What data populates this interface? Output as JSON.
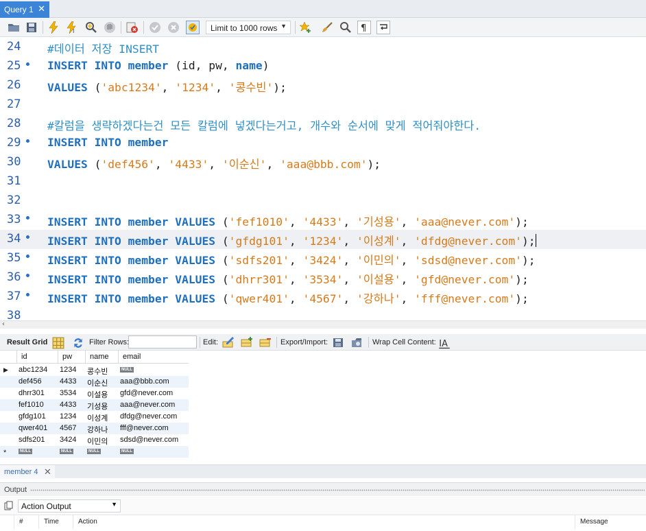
{
  "tab": {
    "title": "Query 1",
    "close": "✕"
  },
  "toolbar": {
    "limit_select": "Limit to 1000 rows",
    "icons": [
      "open-folder-icon",
      "save-icon",
      "execute-icon",
      "execute-current-icon",
      "explain-icon",
      "stop-icon",
      "toggle-error-icon",
      "commit-icon",
      "rollback-icon",
      "autocommit-icon",
      "beautify-icon",
      "brush-icon",
      "find-icon",
      "invisible-chars-icon",
      "wrap-icon"
    ]
  },
  "editor": {
    "lines": [
      {
        "n": "24",
        "dot": false,
        "segments": [
          {
            "t": "#데이터 저장 INSERT",
            "c": "cmt"
          }
        ]
      },
      {
        "n": "25",
        "dot": true,
        "segments": [
          {
            "t": "INSERT INTO member ",
            "c": "kw"
          },
          {
            "t": "(id, pw, ",
            "c": ""
          },
          {
            "t": "name",
            "c": "kw"
          },
          {
            "t": ")",
            "c": ""
          }
        ]
      },
      {
        "n": "26",
        "dot": false,
        "segments": [
          {
            "t": "VALUES ",
            "c": "kw"
          },
          {
            "t": "(",
            "c": ""
          },
          {
            "t": "'abc1234'",
            "c": "str"
          },
          {
            "t": ", ",
            "c": ""
          },
          {
            "t": "'1234'",
            "c": "str"
          },
          {
            "t": ", ",
            "c": ""
          },
          {
            "t": "'콩수빈'",
            "c": "str"
          },
          {
            "t": ");",
            "c": ""
          }
        ]
      },
      {
        "n": "27",
        "dot": false,
        "segments": []
      },
      {
        "n": "28",
        "dot": false,
        "segments": [
          {
            "t": "#칼럼을 생략하겠다는건 모든 칼럼에 넣겠다는거고, 개수와 순서에 맞게 적어줘야한다.",
            "c": "cmt"
          }
        ]
      },
      {
        "n": "29",
        "dot": true,
        "segments": [
          {
            "t": "INSERT INTO member",
            "c": "kw"
          }
        ]
      },
      {
        "n": "30",
        "dot": false,
        "segments": [
          {
            "t": "VALUES ",
            "c": "kw"
          },
          {
            "t": "(",
            "c": ""
          },
          {
            "t": "'def456'",
            "c": "str"
          },
          {
            "t": ", ",
            "c": ""
          },
          {
            "t": "'4433'",
            "c": "str"
          },
          {
            "t": ", ",
            "c": ""
          },
          {
            "t": "'이순신'",
            "c": "str"
          },
          {
            "t": ", ",
            "c": ""
          },
          {
            "t": "'aaa@bbb.com'",
            "c": "str"
          },
          {
            "t": ");",
            "c": ""
          }
        ]
      },
      {
        "n": "31",
        "dot": false,
        "segments": []
      },
      {
        "n": "32",
        "dot": false,
        "segments": []
      },
      {
        "n": "33",
        "dot": true,
        "segments": [
          {
            "t": "INSERT INTO member VALUES ",
            "c": "kw"
          },
          {
            "t": "(",
            "c": ""
          },
          {
            "t": "'fef1010'",
            "c": "str"
          },
          {
            "t": ", ",
            "c": ""
          },
          {
            "t": "'4433'",
            "c": "str"
          },
          {
            "t": ", ",
            "c": ""
          },
          {
            "t": "'기성용'",
            "c": "str"
          },
          {
            "t": ", ",
            "c": ""
          },
          {
            "t": "'aaa@never.com'",
            "c": "str"
          },
          {
            "t": ");",
            "c": ""
          }
        ]
      },
      {
        "n": "34",
        "dot": true,
        "current": true,
        "segments": [
          {
            "t": "INSERT INTO member VALUES ",
            "c": "kw"
          },
          {
            "t": "(",
            "c": ""
          },
          {
            "t": "'gfdg101'",
            "c": "str"
          },
          {
            "t": ", ",
            "c": ""
          },
          {
            "t": "'1234'",
            "c": "str"
          },
          {
            "t": ", ",
            "c": ""
          },
          {
            "t": "'이성계'",
            "c": "str"
          },
          {
            "t": ", ",
            "c": ""
          },
          {
            "t": "'dfdg@never.com'",
            "c": "str"
          },
          {
            "t": ");",
            "c": ""
          }
        ]
      },
      {
        "n": "35",
        "dot": true,
        "segments": [
          {
            "t": "INSERT INTO member VALUES ",
            "c": "kw"
          },
          {
            "t": "(",
            "c": ""
          },
          {
            "t": "'sdfs201'",
            "c": "str"
          },
          {
            "t": ", ",
            "c": ""
          },
          {
            "t": "'3424'",
            "c": "str"
          },
          {
            "t": ", ",
            "c": ""
          },
          {
            "t": "'이민의'",
            "c": "str"
          },
          {
            "t": ", ",
            "c": ""
          },
          {
            "t": "'sdsd@never.com'",
            "c": "str"
          },
          {
            "t": ");",
            "c": ""
          }
        ]
      },
      {
        "n": "36",
        "dot": true,
        "segments": [
          {
            "t": "INSERT INTO member VALUES ",
            "c": "kw"
          },
          {
            "t": "(",
            "c": ""
          },
          {
            "t": "'dhrr301'",
            "c": "str"
          },
          {
            "t": ", ",
            "c": ""
          },
          {
            "t": "'3534'",
            "c": "str"
          },
          {
            "t": ", ",
            "c": ""
          },
          {
            "t": "'이설용'",
            "c": "str"
          },
          {
            "t": ", ",
            "c": ""
          },
          {
            "t": "'gfd@never.com'",
            "c": "str"
          },
          {
            "t": ");",
            "c": ""
          }
        ]
      },
      {
        "n": "37",
        "dot": true,
        "segments": [
          {
            "t": "INSERT INTO member VALUES ",
            "c": "kw"
          },
          {
            "t": "(",
            "c": ""
          },
          {
            "t": "'qwer401'",
            "c": "str"
          },
          {
            "t": ", ",
            "c": ""
          },
          {
            "t": "'4567'",
            "c": "str"
          },
          {
            "t": ", ",
            "c": ""
          },
          {
            "t": "'강하나'",
            "c": "str"
          },
          {
            "t": ", ",
            "c": ""
          },
          {
            "t": "'fff@never.com'",
            "c": "str"
          },
          {
            "t": ");",
            "c": ""
          }
        ]
      },
      {
        "n": "38",
        "dot": false,
        "segments": []
      }
    ]
  },
  "result_toolbar": {
    "result_grid": "Result Grid",
    "filter_rows": "Filter Rows:",
    "edit": "Edit:",
    "export_import": "Export/Import:",
    "wrap_cell": "Wrap Cell Content:"
  },
  "grid": {
    "columns": [
      "id",
      "pw",
      "name",
      "email"
    ],
    "null_label": "NULL",
    "rows": [
      [
        "abc1234",
        "1234",
        "콩수빈",
        null
      ],
      [
        "def456",
        "4433",
        "이순신",
        "aaa@bbb.com"
      ],
      [
        "dhrr301",
        "3534",
        "이설용",
        "gfd@never.com"
      ],
      [
        "fef1010",
        "4433",
        "기성용",
        "aaa@never.com"
      ],
      [
        "gfdg101",
        "1234",
        "이성계",
        "dfdg@never.com"
      ],
      [
        "qwer401",
        "4567",
        "강하나",
        "fff@never.com"
      ],
      [
        "sdfs201",
        "3424",
        "이민의",
        "sdsd@never.com"
      ]
    ]
  },
  "result_tab": {
    "label": "member 4",
    "close": "✕"
  },
  "output": {
    "title": "Output",
    "action_select": "Action Output",
    "columns": [
      "#",
      "Time",
      "Action",
      "Message"
    ]
  }
}
